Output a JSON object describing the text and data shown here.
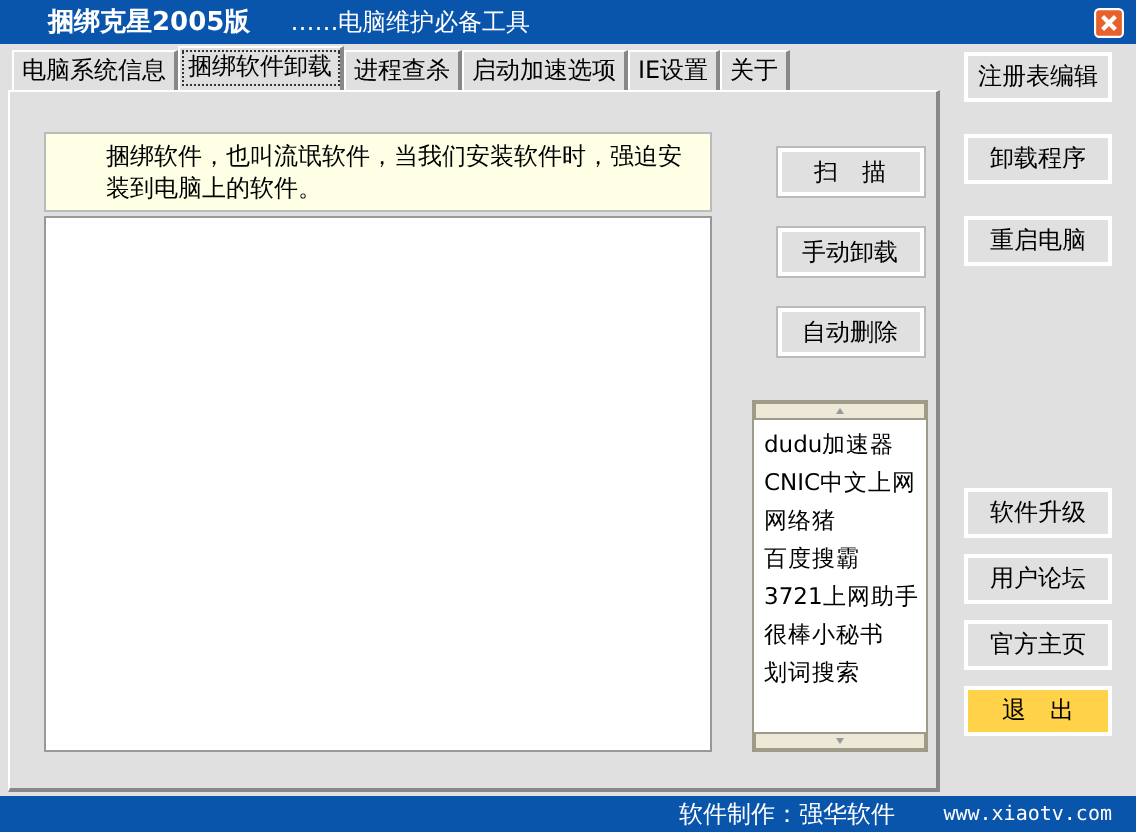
{
  "window": {
    "title": "捆绑克星2005版",
    "subtitle": "……电脑维护必备工具"
  },
  "tabs": [
    {
      "label": "电脑系统信息",
      "selected": false
    },
    {
      "label": "捆绑软件卸载",
      "selected": true
    },
    {
      "label": "进程查杀",
      "selected": false
    },
    {
      "label": "启动加速选项",
      "selected": false
    },
    {
      "label": "IE设置",
      "selected": false
    },
    {
      "label": "关于",
      "selected": false
    }
  ],
  "info_text": "捆绑软件，也叫流氓软件，当我们安装软件时，强迫安装到电脑上的软件。",
  "action_buttons": [
    "扫　描",
    "手动卸载",
    "自动删除"
  ],
  "software_list": [
    "dudu加速器",
    "CNIC中文上网",
    "网络猪",
    "百度搜霸",
    "3721上网助手",
    "很棒小秘书",
    "划词搜索"
  ],
  "side_buttons": [
    {
      "label": "注册表编辑",
      "kind": "normal"
    },
    {
      "label": "卸载程序",
      "kind": "normal"
    },
    {
      "label": "重启电脑",
      "kind": "normal"
    },
    {
      "label": "软件升级",
      "kind": "normal"
    },
    {
      "label": "用户论坛",
      "kind": "normal"
    },
    {
      "label": "官方主页",
      "kind": "normal"
    },
    {
      "label": "退　出",
      "kind": "exit"
    }
  ],
  "status_bar": {
    "credit": "软件制作：强华软件",
    "url": "www.xiaotv.com"
  }
}
